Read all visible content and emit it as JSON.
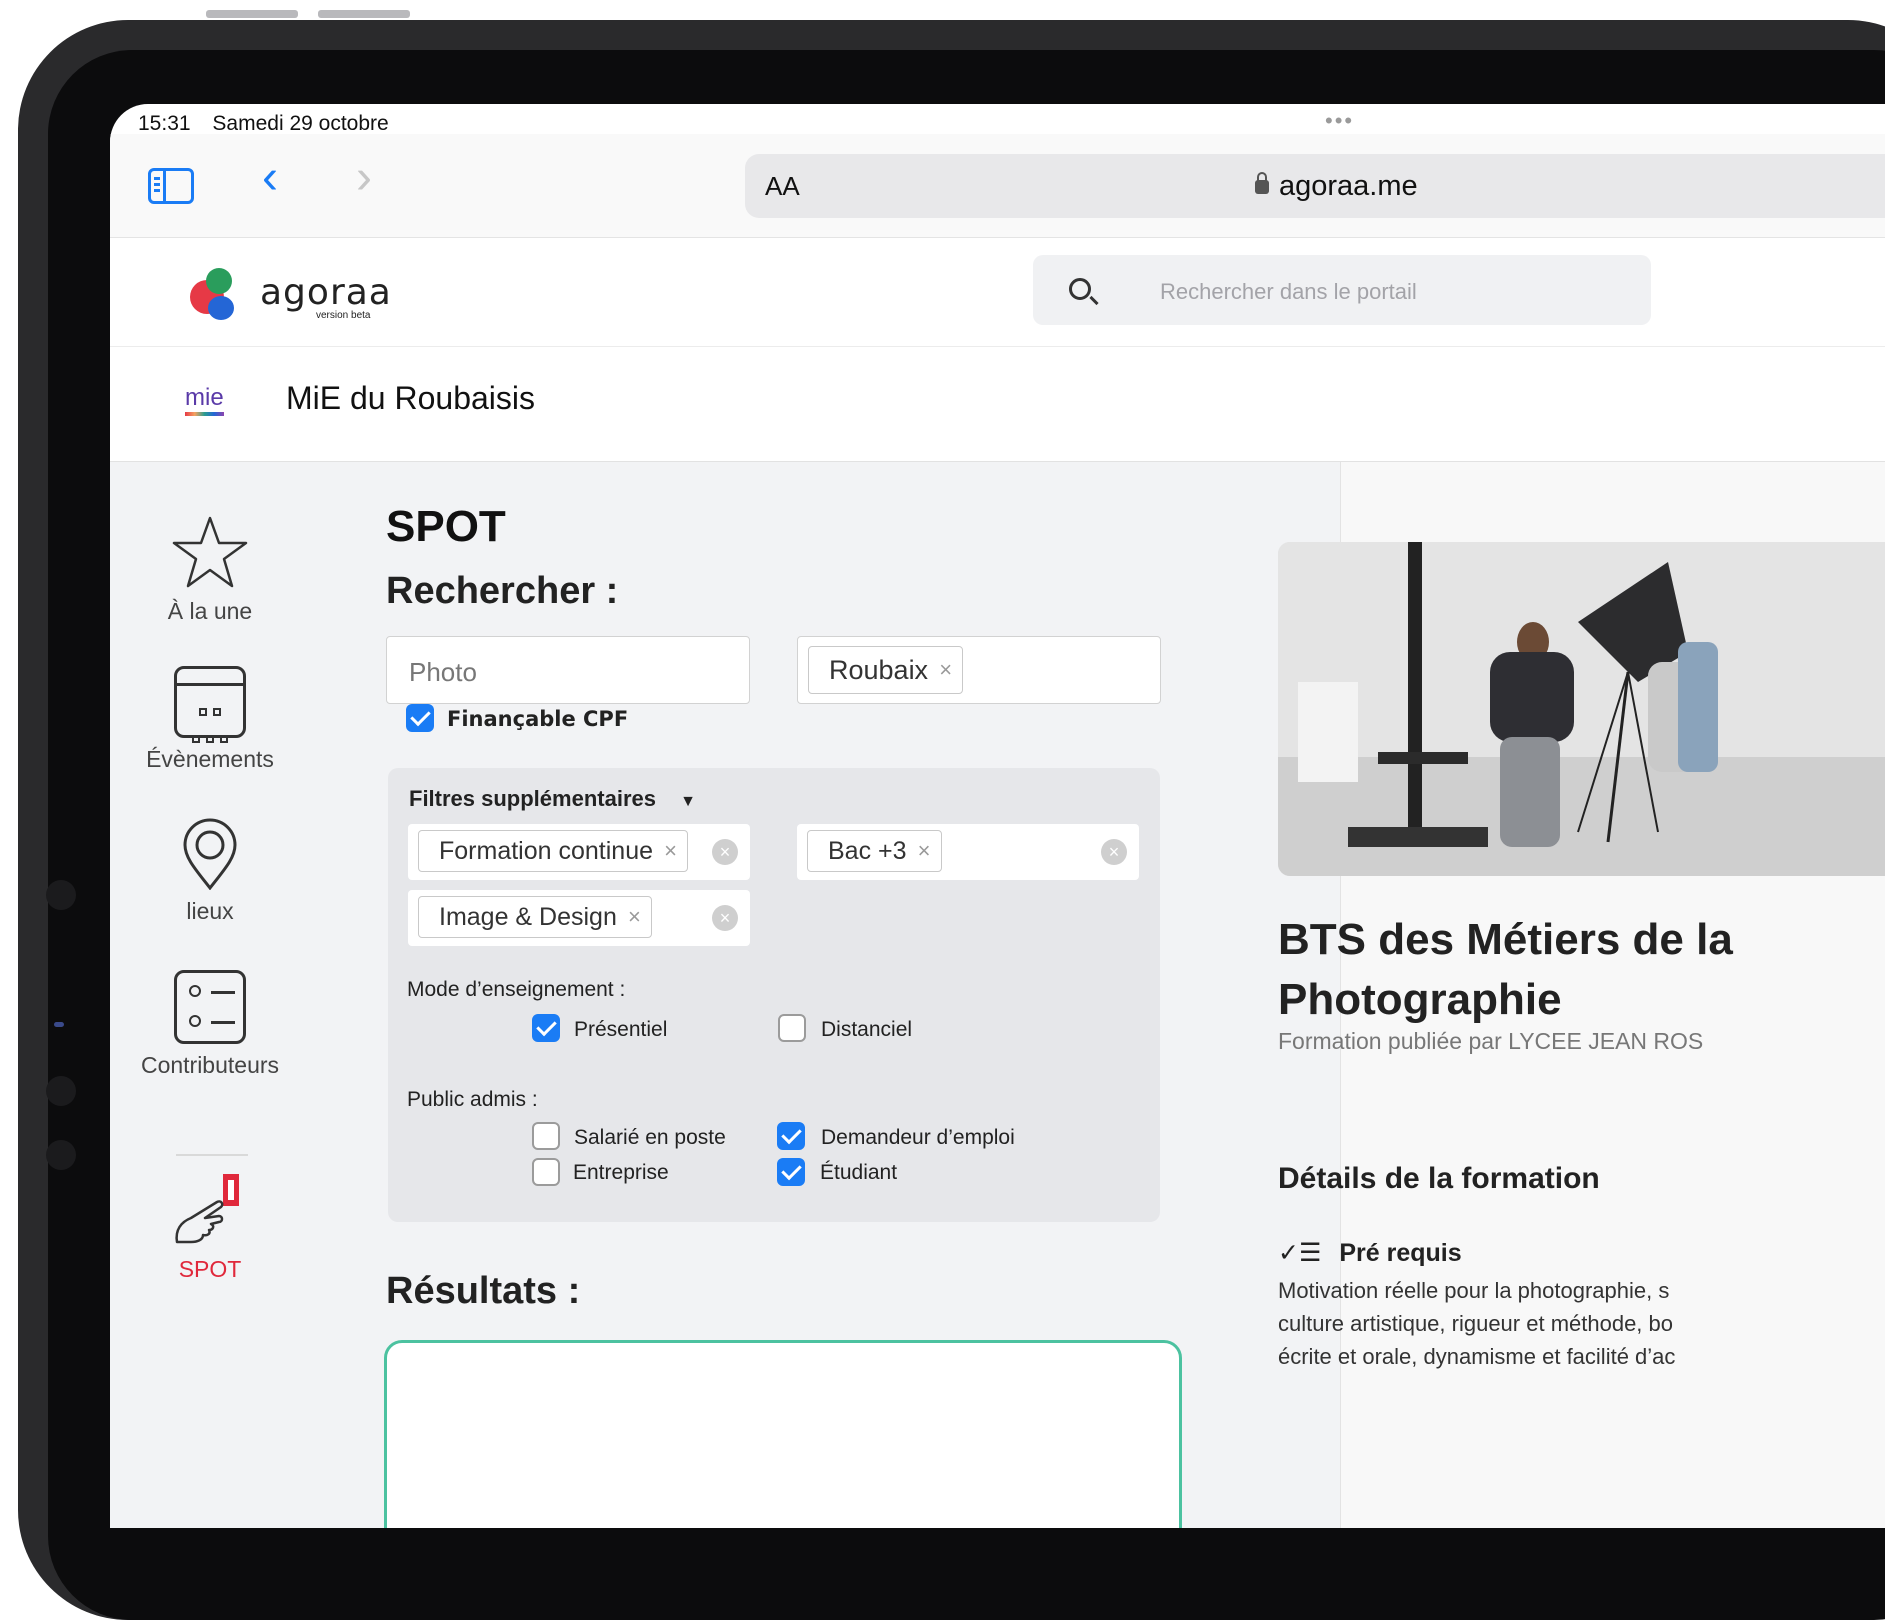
{
  "status_bar": {
    "time": "15:31",
    "date": "Samedi 29 octobre"
  },
  "browser": {
    "text_size_button": "AA",
    "url": "agoraa.me"
  },
  "site": {
    "logo_name": "agoraa",
    "logo_tag": "version beta",
    "search_placeholder": "Rechercher dans le portail"
  },
  "org": {
    "logo_text": "mie",
    "name": "MiE du Roubaisis"
  },
  "nav": {
    "items": [
      {
        "label": "À la une",
        "icon": "star-icon"
      },
      {
        "label": "Évènements",
        "icon": "calendar-icon"
      },
      {
        "label": "lieux",
        "icon": "map-pin-icon"
      },
      {
        "label": "Contributeurs",
        "icon": "contacts-icon"
      },
      {
        "label": "SPOT",
        "icon": "pointing-hand-icon"
      }
    ],
    "active_color": "#e0283b"
  },
  "search": {
    "title": "SPOT",
    "heading": "Rechercher :",
    "keyword_value": "Photo",
    "location_chip": "Roubaix",
    "cpf_label": "Finançable CPF",
    "cpf_checked": true
  },
  "filters": {
    "toggle_label": "Filtres supplémentaires",
    "chip_formation": "Formation continue",
    "chip_level": "Bac +3",
    "chip_domain": "Image & Design",
    "mode_label": "Mode d’enseignement :",
    "mode_options": [
      {
        "label": "Présentiel",
        "checked": true
      },
      {
        "label": "Distanciel",
        "checked": false
      }
    ],
    "public_label": "Public admis :",
    "public_options": [
      {
        "label": "Salarié en poste",
        "checked": false
      },
      {
        "label": "Demandeur d’emploi",
        "checked": true
      },
      {
        "label": "Entreprise",
        "checked": false
      },
      {
        "label": "Étudiant",
        "checked": true
      }
    ]
  },
  "results": {
    "heading": "Résultats :"
  },
  "detail": {
    "title": "BTS des Métiers de la Photographie",
    "publisher": "Formation publiée par LYCEE JEAN ROS",
    "section_heading": "Détails de la formation",
    "prereq_heading": "Pré requis",
    "prereq_text": "Motivation réelle pour la photographie, s\nculture artistique, rigueur et méthode, bo\nécrite et orale, dynamisme et facilité d’ac"
  },
  "colors": {
    "accent_blue": "#1a7cf5",
    "result_border": "#4cc2a0"
  }
}
